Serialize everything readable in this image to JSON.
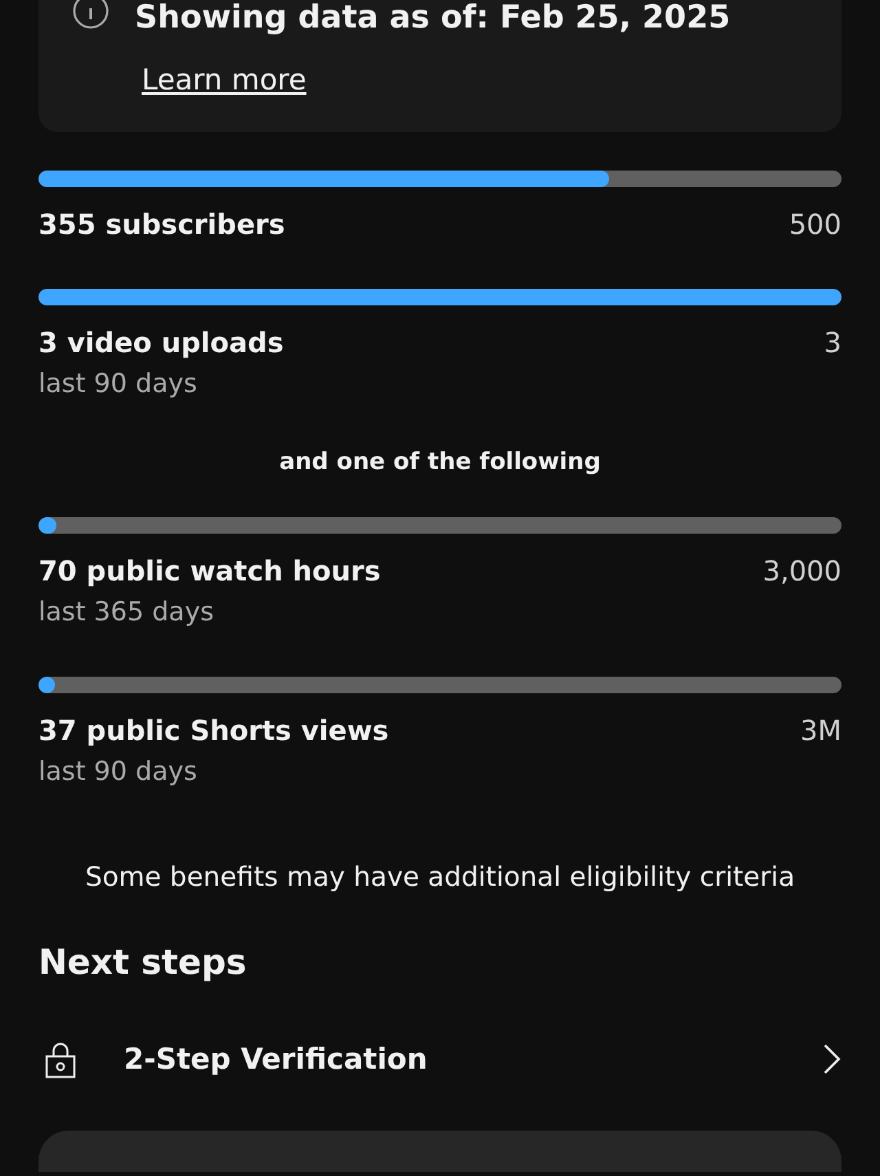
{
  "notice": {
    "text": "Showing data as of: Feb 25, 2025",
    "link": "Learn more"
  },
  "requirements": [
    {
      "label": "355 subscribers",
      "target": "500",
      "level": 0.71
    },
    {
      "label": "3 video uploads",
      "target": "3",
      "sublabel": "last 90 days",
      "level": 1
    }
  ],
  "separator": "and one of the following",
  "alternatives": [
    {
      "label": "70 public watch hours",
      "target": "3,000",
      "sublabel": "last 365 days",
      "level": 0.023
    },
    {
      "label": "37 public Shorts views",
      "target": "3M",
      "sublabel": "last 90 days",
      "level": 0
    }
  ],
  "disclaimer": "Some benefits may have additional eligibility criteria",
  "next_steps": {
    "title": "Next steps",
    "items": [
      {
        "label": "2-Step Verification"
      }
    ]
  }
}
